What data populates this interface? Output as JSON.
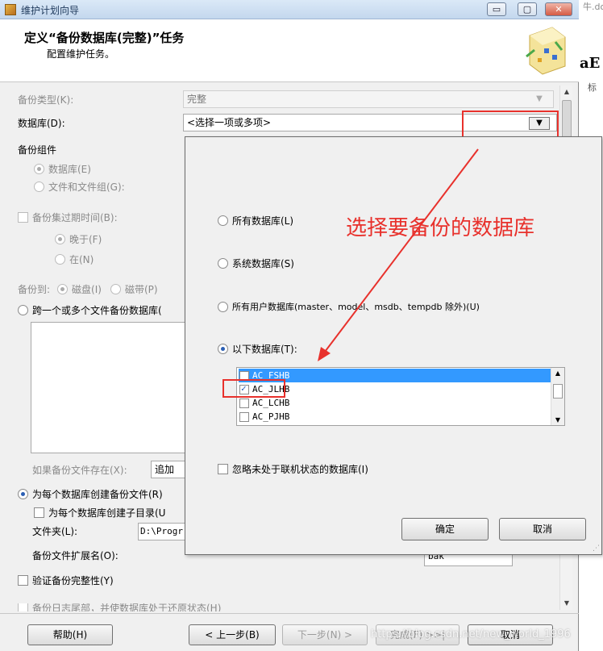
{
  "window": {
    "title": "维护计划向导",
    "header_title": "定义“备份数据库(完整)”任务",
    "header_subtitle": "配置维护任务。",
    "controls": {
      "minimize": "▭",
      "maximize": "▢",
      "close": "✕"
    }
  },
  "form": {
    "backup_type_label": "备份类型(K):",
    "backup_type_value": "完整",
    "database_label": "数据库(D):",
    "database_value": "<选择一项或多项>",
    "backup_component_label": "备份组件",
    "component_database": "数据库(E)",
    "component_files": "文件和文件组(G):",
    "backup_set_expire": "备份集过期时间(B):",
    "expire_after": "晚于(F)",
    "expire_on": "在(N)",
    "backup_to_label": "备份到:",
    "backup_to_disk": "磁盘(I)",
    "backup_to_tape": "磁带(P)",
    "span_files": "跨一个或多个文件备份数据库(",
    "if_exists_label": "如果备份文件存在(X):",
    "if_exists_value": "追加",
    "create_file_per_db": "为每个数据库创建备份文件(R)",
    "create_subdir": "为每个数据库创建子目录(U",
    "folder_label": "文件夹(L):",
    "folder_value": "D:\\Progr",
    "extension_label": "备份文件扩展名(O):",
    "extension_value": "bak",
    "verify_integrity": "验证备份完整性(Y)",
    "backup_log_tail": "备份日志尾部，并使数据库处于还原状态(H)"
  },
  "footer": {
    "help": "帮助(H)",
    "back": "< 上一步(B)",
    "next": "下一步(N) >",
    "finish": "完成(F) >>|",
    "cancel": "取消",
    "watermark": "https://blog.csdn.net/new_world_1996"
  },
  "popup": {
    "opt_all": "所有数据库(L)",
    "opt_system": "系统数据库(S)",
    "opt_user": "所有用户数据库(master、model、msdb、tempdb 除外)(U)",
    "opt_these": "以下数据库(T):",
    "databases": [
      {
        "name": "AC_FSHB",
        "checked": false,
        "selected": true
      },
      {
        "name": "AC_JLHB",
        "checked": true,
        "selected": false
      },
      {
        "name": "AC_LCHB",
        "checked": false,
        "selected": false
      },
      {
        "name": "AC_PJHB",
        "checked": false,
        "selected": false
      }
    ],
    "ignore_offline": "忽略未处于联机状态的数据库(I)",
    "ok": "确定",
    "cancel": "取消"
  },
  "annotation": {
    "text": "选择要备份的数据库",
    "color": "#e8312c"
  },
  "background_window": {
    "text_top": "牛.do",
    "text_aa": "aE",
    "text_label": "标"
  }
}
